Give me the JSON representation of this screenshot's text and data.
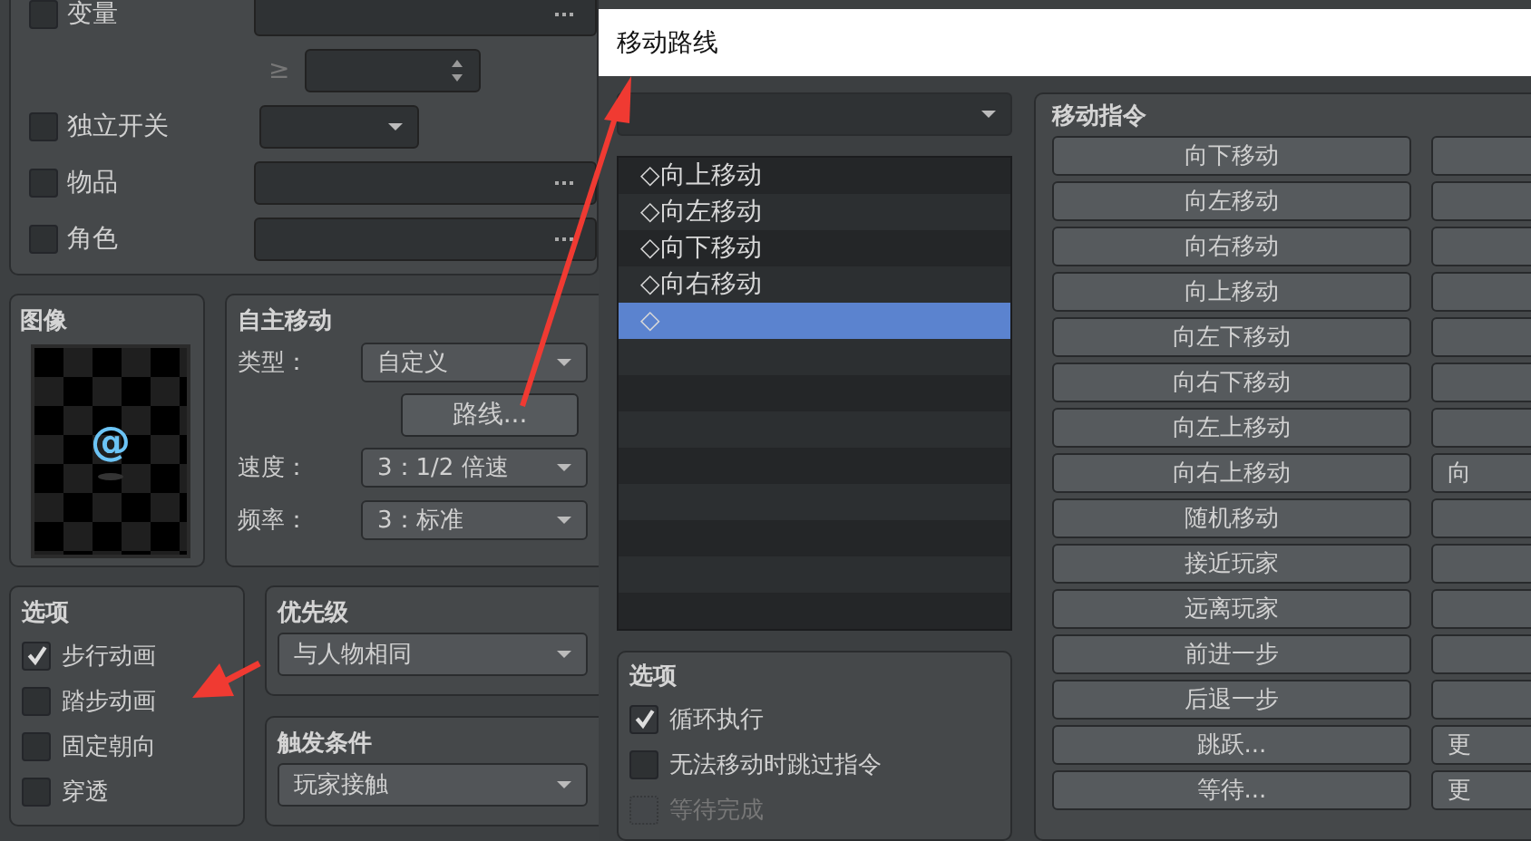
{
  "conditions": [
    {
      "kind": "variable",
      "label": "变量",
      "checked": false,
      "compare": "≥"
    },
    {
      "kind": "switch",
      "label": "独立开关",
      "checked": false
    },
    {
      "kind": "picker",
      "label": "物品",
      "checked": false
    },
    {
      "kind": "picker",
      "label": "角色",
      "checked": false
    }
  ],
  "image": {
    "title": "图像",
    "sprite": "@"
  },
  "autonomous_movement": {
    "title": "自主移动",
    "type_label": "类型：",
    "type_value": "自定义",
    "route_button": "路线...",
    "speed_label": "速度：",
    "speed_value": "3：1/2 倍速",
    "frequency_label": "频率：",
    "frequency_value": "3：标准"
  },
  "options": {
    "title": "选项",
    "items": [
      {
        "label": "步行动画",
        "checked": true
      },
      {
        "label": "踏步动画",
        "checked": false
      },
      {
        "label": "固定朝向",
        "checked": false
      },
      {
        "label": "穿透",
        "checked": false
      }
    ]
  },
  "priority": {
    "title": "优先级",
    "value": "与人物相同"
  },
  "trigger": {
    "title": "触发条件",
    "value": "玩家接触"
  },
  "dialog": {
    "title": "移动路线",
    "route_list": [
      {
        "text": "◇向上移动",
        "selected": false
      },
      {
        "text": "◇向左移动",
        "selected": false
      },
      {
        "text": "◇向下移动",
        "selected": false
      },
      {
        "text": "◇向右移动",
        "selected": false
      },
      {
        "text": "◇",
        "selected": true
      }
    ],
    "options": {
      "title": "选项",
      "items": [
        {
          "label": "循环执行",
          "checked": true,
          "disabled": false
        },
        {
          "label": "无法移动时跳过指令",
          "checked": false,
          "disabled": false
        },
        {
          "label": "等待完成",
          "checked": false,
          "disabled": true
        }
      ]
    },
    "commands": {
      "title": "移动指令",
      "column_1": [
        "向下移动",
        "向左移动",
        "向右移动",
        "向上移动",
        "向左下移动",
        "向右下移动",
        "向左上移动",
        "向右上移动",
        "随机移动",
        "接近玩家",
        "远离玩家",
        "前进一步",
        "后退一步",
        "跳跃...",
        "等待..."
      ],
      "column_2": [
        {
          "kind": "blank"
        },
        {
          "kind": "blank"
        },
        {
          "kind": "blank"
        },
        {
          "kind": "blank"
        },
        {
          "kind": "blank"
        },
        {
          "kind": "blank"
        },
        {
          "kind": "blank"
        },
        {
          "kind": "text",
          "label": "向"
        },
        {
          "kind": "blank"
        },
        {
          "kind": "blank"
        },
        {
          "kind": "blank"
        },
        {
          "kind": "blank"
        },
        {
          "kind": "blank"
        },
        {
          "kind": "text",
          "label": "更"
        },
        {
          "kind": "text",
          "label": "更"
        }
      ]
    }
  }
}
